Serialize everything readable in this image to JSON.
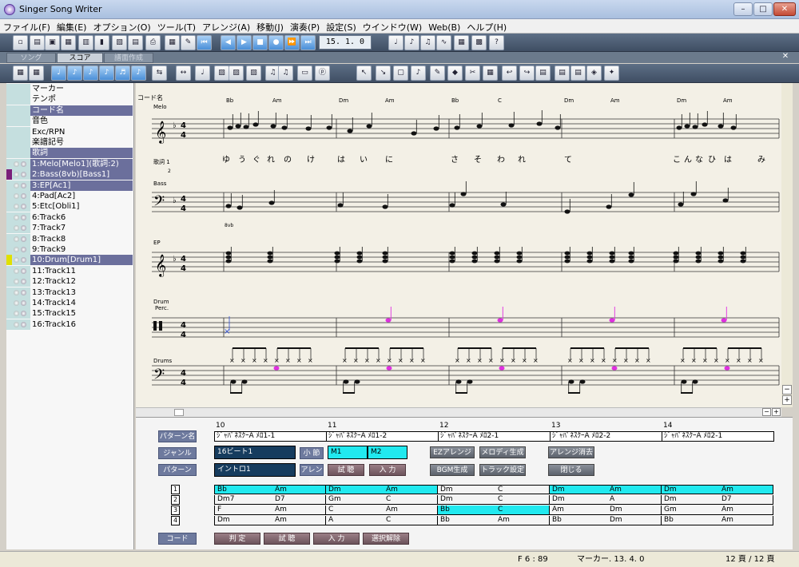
{
  "window": {
    "title": "Singer Song Writer"
  },
  "menu": [
    "ファイル(F)",
    "編集(E)",
    "オプション(O)",
    "ツール(T)",
    "アレンジ(A)",
    "移動(J)",
    "演奏(P)",
    "設定(S)",
    "ウインドウ(W)",
    "Web(B)",
    "ヘルプ(H)"
  ],
  "transport": {
    "counter": "15. 1. 0"
  },
  "tabs": [
    "ソング",
    "スコア",
    "譜面作成"
  ],
  "tracks": [
    {
      "label": "マーカー",
      "selected": false
    },
    {
      "label": "テンポ",
      "selected": false
    },
    {
      "label": "コード名",
      "selected": true
    },
    {
      "label": "音色",
      "selected": false
    },
    {
      "label": "Exc/RPN",
      "selected": false
    },
    {
      "label": "楽譜記号",
      "selected": false
    },
    {
      "label": "歌詞",
      "selected": true
    },
    {
      "label": "1:Melo[Melo1](歌詞:2)",
      "selected": true
    },
    {
      "label": "2:Bass(8vb)[Bass1]",
      "selected": true
    },
    {
      "label": "3:EP[Ac1]",
      "selected": true
    },
    {
      "label": "4:Pad[Ac2]",
      "selected": false
    },
    {
      "label": "5:Etc[Obli1]",
      "selected": false
    },
    {
      "label": "6:Track6",
      "selected": false
    },
    {
      "label": "7:Track7",
      "selected": false
    },
    {
      "label": "8:Track8",
      "selected": false
    },
    {
      "label": "9:Track9",
      "selected": false
    },
    {
      "label": "10:Drum[Drum1]",
      "selected": true
    },
    {
      "label": "11:Track11",
      "selected": false
    },
    {
      "label": "12:Track12",
      "selected": false
    },
    {
      "label": "13:Track13",
      "selected": false
    },
    {
      "label": "14:Track14",
      "selected": false
    },
    {
      "label": "15:Track15",
      "selected": false
    },
    {
      "label": "16:Track16",
      "selected": false
    }
  ],
  "score": {
    "measures": [
      "10",
      "11",
      "12",
      "13",
      "14"
    ],
    "chord_label": "コード名",
    "chords": [
      [
        "Bb",
        "Am"
      ],
      [
        "Dm",
        "Am"
      ],
      [
        "Bb",
        "C"
      ],
      [
        "Dm",
        "Am"
      ],
      [
        "Dm",
        "Am"
      ]
    ],
    "staff_labels": {
      "melo": "Melo",
      "lyrics": "歌詞 1",
      "lyrics_sub": "2",
      "bass": "Bass",
      "octave": "8vb",
      "ep": "EP",
      "drum": "Drum",
      "perc": "Perc.",
      "drums": "Drums"
    },
    "lyrics": [
      "ゆ",
      "う",
      "ぐ",
      "れ",
      "の",
      "け",
      "は",
      "い",
      "に",
      "さ",
      "そ",
      "わ",
      "れ",
      "て",
      "こ",
      "ん",
      "な",
      "ひ",
      "は",
      "み"
    ],
    "time_sig": "4/4",
    "colors": {
      "paper": "#f3f0e6",
      "accent": "#e030e0",
      "x_note": "#3050d0"
    }
  },
  "arrange": {
    "pattern_label": "パターン名",
    "measures": [
      "10",
      "11",
      "12",
      "13",
      "14"
    ],
    "patterns": [
      "ｼﾞｬﾊﾟﾈｽｸｰA ﾒﾛ1-1",
      "ｼﾞｬﾊﾟﾈｽｸｰA ﾒﾛ1-2",
      "ｼﾞｬﾊﾟﾈｽｸｰA ﾒﾛ2-1",
      "ｼﾞｬﾊﾟﾈｽｸｰA ﾒﾛ2-2",
      "ｼﾞｬﾊﾟﾈｽｸｰA ﾒﾛ2-1"
    ],
    "genre_label": "ジャンル",
    "genre_value": "16ビート1",
    "bar_label": "小 節",
    "bar_values": [
      "M1",
      "M2"
    ],
    "pattern2_label": "パターン",
    "pattern2_value": "イントロ1",
    "arrange_label": "アレンジ",
    "buttons": {
      "try": "試 聴",
      "input": "入 力",
      "ez": "EZアレンジ",
      "melody": "メロディ生成",
      "clear": "アレンジ消去",
      "bgm": "BGM生成",
      "track": "トラック設定",
      "close": "閉じる"
    },
    "chord_rows": [
      [
        [
          "Bb",
          "Am"
        ],
        [
          "Dm",
          "Am"
        ],
        [
          "Dm",
          "C"
        ],
        [
          "Dm",
          "Am"
        ],
        [
          "Dm",
          "Am"
        ]
      ],
      [
        [
          "Dm7",
          "D7"
        ],
        [
          "Gm",
          "C"
        ],
        [
          "Dm",
          "C"
        ],
        [
          "Dm",
          "A"
        ],
        [
          "Dm",
          "D7"
        ]
      ],
      [
        [
          "F",
          "Am"
        ],
        [
          "C",
          "Am"
        ],
        [
          "Bb",
          "C"
        ],
        [
          "Am",
          "Dm"
        ],
        [
          "Gm",
          "Am"
        ]
      ],
      [
        [
          "Dm",
          "Am"
        ],
        [
          "A",
          "C"
        ],
        [
          "Bb",
          "Am"
        ],
        [
          "Bb",
          "Dm"
        ],
        [
          "Bb",
          "Am"
        ]
      ]
    ],
    "row_nums": [
      "1",
      "2",
      "3",
      "4"
    ],
    "chord_label": "コード",
    "chord_buttons": [
      "判 定",
      "試 聴",
      "入 力",
      "選択解除"
    ]
  },
  "status": {
    "position": "F 6 : 89",
    "marker": "マーカー. 13. 4. 0",
    "page": "12 頁 /  12 頁"
  }
}
